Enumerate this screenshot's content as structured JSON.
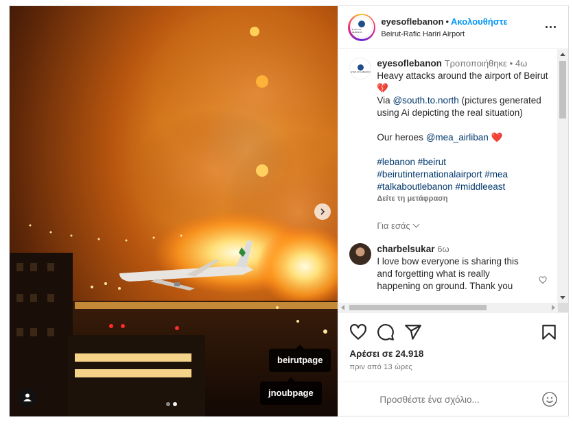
{
  "header": {
    "username": "eyesoflebanon",
    "separator": "•",
    "follow_label": "Ακολουθήστε",
    "location": "Beirut-Rafic Hariri Airport",
    "avatar_brand": "EYES OF LEBANON"
  },
  "media": {
    "tags": [
      "beirutpage",
      "jnoubpage"
    ],
    "carousel_dots": 2,
    "active_dot": 1
  },
  "caption": {
    "username": "eyesoflebanon",
    "edited": "Τροποποιήθηκε",
    "dot": "•",
    "age": "4ω",
    "line1": "Heavy attacks around the airport of Beirut",
    "emoji1": "💔",
    "via_prefix": "Via",
    "via_handle": "@south.to.north",
    "via_suffix": "(pictures generated using Ai depicting the real situation)",
    "heroes_prefix": "Our heroes",
    "heroes_handle": "@mea_airliban",
    "emoji2": "❤️",
    "hashtags": "#lebanon #beirut #beirutinternationalairport #mea #talkaboutlebanon #middleeast",
    "translate_label": "Δείτε τη μετάφραση"
  },
  "for_you_label": "Για εσάς",
  "comment": {
    "username": "charbelsukar",
    "age": "6ω",
    "text": "I love bow everyone is sharing this and forgetting what is really happening on ground. Thank you"
  },
  "likes_label": "Αρέσει σε 24.918",
  "time_label": "πριν από 13 ώρες",
  "comment_input": {
    "placeholder": "Προσθέστε ένα σχόλιο..."
  },
  "icons": {
    "like": "heart-icon",
    "comment": "comment-icon",
    "share": "share-icon",
    "save": "bookmark-icon",
    "emoji": "emoji-icon",
    "more": "more-options-icon",
    "next": "chevron-right-icon",
    "user_tag": "user-tag-icon"
  },
  "colors": {
    "follow": "#0095f6",
    "link": "#00376b",
    "secondary": "#737373",
    "heart": "#ed4956"
  }
}
